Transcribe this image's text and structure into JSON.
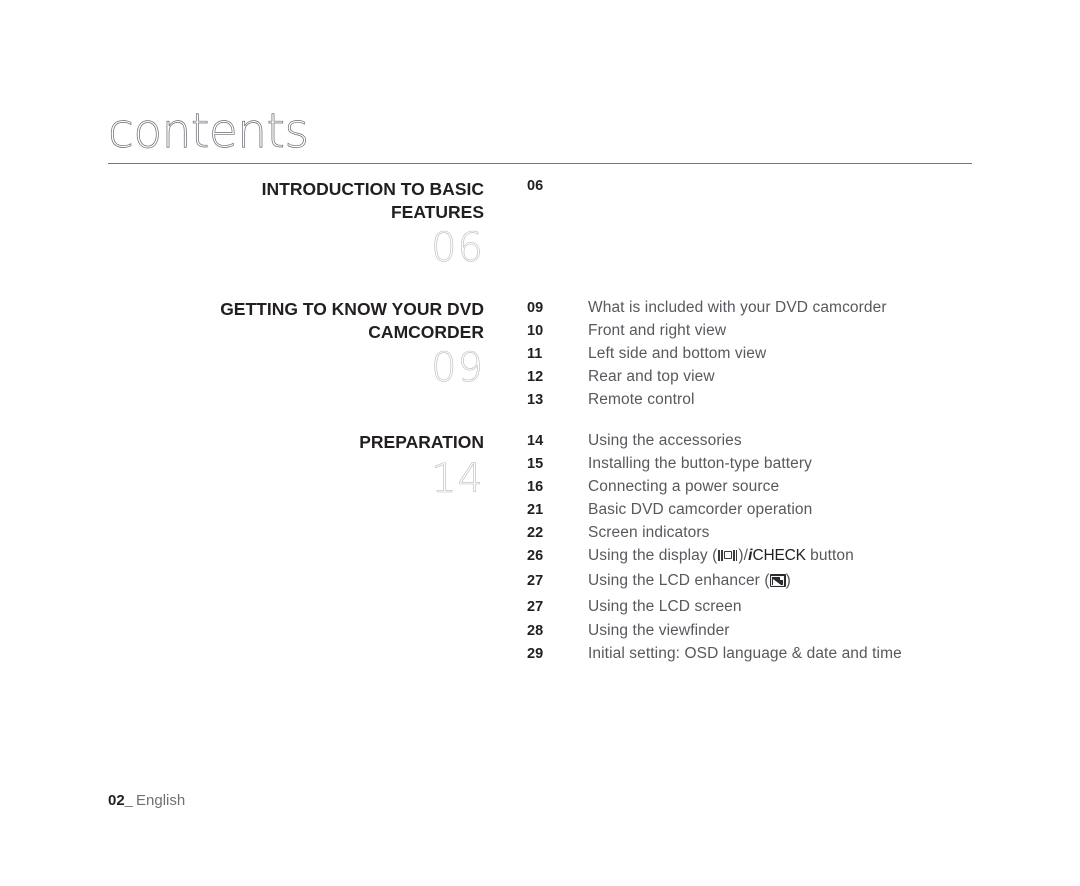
{
  "page": {
    "title": "contents",
    "footer_number": "02_",
    "footer_language": "English"
  },
  "sections": [
    {
      "heading_line1": "INTRODUCTION TO BASIC",
      "heading_line2": "FEATURES",
      "big_number": "06",
      "entries": [
        {
          "page": "06",
          "title": ""
        }
      ]
    },
    {
      "heading_line1": "GETTING TO KNOW YOUR DVD",
      "heading_line2": "CAMCORDER",
      "big_number": "09",
      "entries": [
        {
          "page": "09",
          "title": "What is included with your DVD camcorder"
        },
        {
          "page": "10",
          "title": "Front and right view"
        },
        {
          "page": "11",
          "title": "Left side and bottom view"
        },
        {
          "page": "12",
          "title": "Rear and top view"
        },
        {
          "page": "13",
          "title": "Remote control"
        }
      ]
    },
    {
      "heading_line1": "PREPARATION",
      "heading_line2": "",
      "big_number": "14",
      "entries": [
        {
          "page": "14",
          "title": "Using the accessories"
        },
        {
          "page": "15",
          "title": "Installing the button-type battery"
        },
        {
          "page": "16",
          "title": "Connecting a power source"
        },
        {
          "page": "21",
          "title": "Basic DVD camcorder operation"
        },
        {
          "page": "22",
          "title": "Screen indicators"
        },
        {
          "page": "26",
          "title_prefix": "Using the display (",
          "icon": "display-icon",
          "title_mid": ")/",
          "icheck_i": "i",
          "icheck_word": "CHECK",
          "title_suffix": " button"
        },
        {
          "page": "27",
          "title_prefix": "Using the LCD enhancer (",
          "icon": "lcd-enhancer-icon",
          "title_suffix": ")"
        },
        {
          "page": "27",
          "title": "Using the LCD screen"
        },
        {
          "page": "28",
          "title": "Using the viewfinder"
        },
        {
          "page": "29",
          "title": "Initial setting: OSD language & date and time"
        }
      ]
    }
  ],
  "colors": {
    "text_dark": "#231f20",
    "text_gray": "#58585e",
    "ghost_number": "#b9b9c2",
    "rule": "#77777d"
  }
}
